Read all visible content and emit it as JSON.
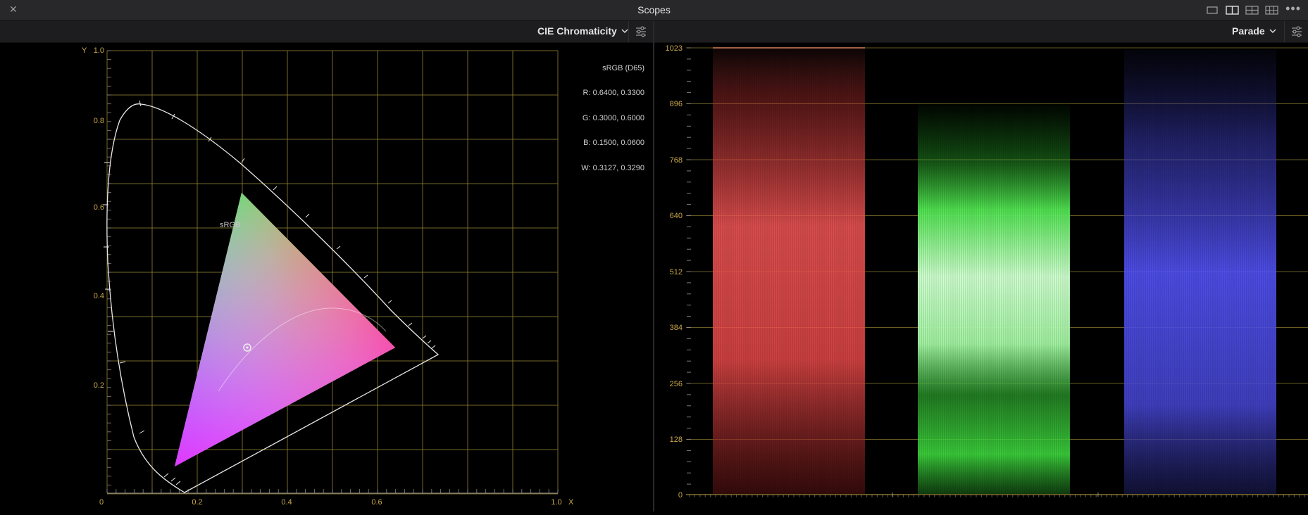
{
  "window": {
    "title": "Scopes"
  },
  "icons": {
    "close": "close-icon",
    "layouts": [
      "layout-single-icon",
      "layout-dual-icon",
      "layout-quad-icon",
      "layout-grid-icon"
    ],
    "more": "more-icon",
    "settings": "settings-sliders-icon",
    "dropdown": "chevron-down-icon"
  },
  "left_scope": {
    "selector_label": "CIE Chromaticity",
    "gamut_label": "sRGB",
    "info": {
      "space": "sRGB (D65)",
      "r": "R: 0.6400, 0.3300",
      "g": "G: 0.3000, 0.6000",
      "b": "B: 0.1500, 0.0600",
      "w": "W: 0.3127, 0.3290"
    },
    "axes": {
      "x_label": "X",
      "y_label": "Y",
      "x_ticks": [
        "0",
        "0.2",
        "0.4",
        "0.6",
        "1.0"
      ],
      "y_ticks": [
        "1.0",
        "0.8",
        "0.6",
        "0.4",
        "0.2"
      ]
    }
  },
  "right_scope": {
    "selector_label": "Parade",
    "y_ticks": [
      "1023",
      "896",
      "768",
      "640",
      "512",
      "384",
      "256",
      "128",
      "0"
    ],
    "channels": [
      "red",
      "green",
      "blue"
    ]
  },
  "colors": {
    "grid": "#8a7a2e",
    "axis_text": "#c8a84a",
    "red_channel": "#ff5555",
    "green_channel": "#55ff55",
    "blue_channel": "#5a5aff"
  }
}
